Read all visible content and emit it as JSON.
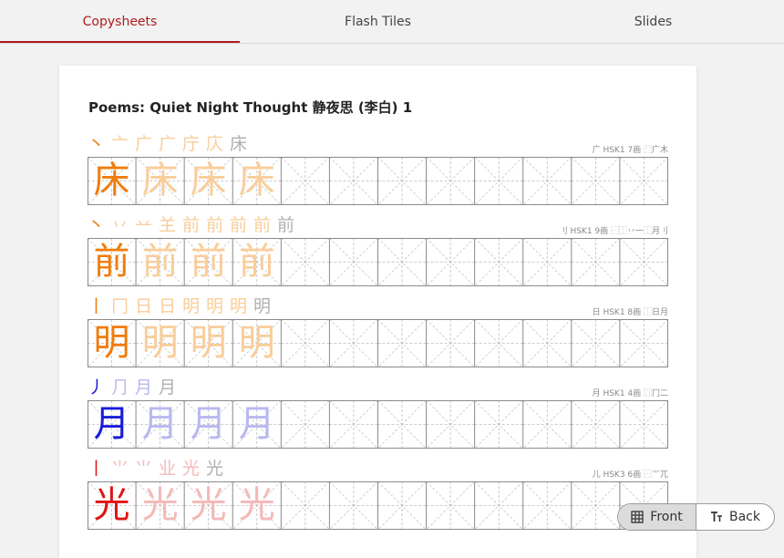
{
  "tabs": [
    {
      "label": "Copysheets",
      "active": true
    },
    {
      "label": "Flash Tiles",
      "active": false
    },
    {
      "label": "Slides",
      "active": false
    }
  ],
  "sheet": {
    "title": "Poems: Quiet Night Thought 静夜思 (李白) 1",
    "rows": [
      {
        "char": "床",
        "color": "#f07c0a",
        "trace_color": "#f9cd9a",
        "meta": "广 HSK1 7画 ⿸广木",
        "strokes": [
          "丶",
          "亠",
          "广",
          "广",
          "庁",
          "庂",
          "床"
        ]
      },
      {
        "char": "前",
        "color": "#f07c0a",
        "trace_color": "#f9cd9a",
        "meta": "刂 HSK1 9画 ⿱⿰丷一⿰月刂",
        "strokes": [
          "丶",
          "丷",
          "䒑",
          "𦍌",
          "前",
          "前",
          "前",
          "前",
          "前"
        ]
      },
      {
        "char": "明",
        "color": "#f07c0a",
        "trace_color": "#f9cd9a",
        "meta": "日 HSK1 8画 ⿰日月",
        "strokes": [
          "丨",
          "冂",
          "日",
          "日",
          "明",
          "明",
          "明",
          "明"
        ]
      },
      {
        "char": "月",
        "color": "#1a1adc",
        "trace_color": "#b8b8f0",
        "meta": "月 HSK1 4画 ⿵冂二",
        "strokes": [
          "丿",
          "⺆",
          "月",
          "月"
        ]
      },
      {
        "char": "光",
        "color": "#e01414",
        "trace_color": "#f6b8b8",
        "meta": "儿 HSK3 6画 ⿱⺌兀",
        "strokes": [
          "丨",
          "⺌",
          "⺌",
          "业",
          "光",
          "光"
        ]
      }
    ]
  },
  "toggle": {
    "front_label": "Front",
    "back_label": "Back",
    "front_icon": "grid-icon",
    "back_icon": "text-size-icon"
  }
}
